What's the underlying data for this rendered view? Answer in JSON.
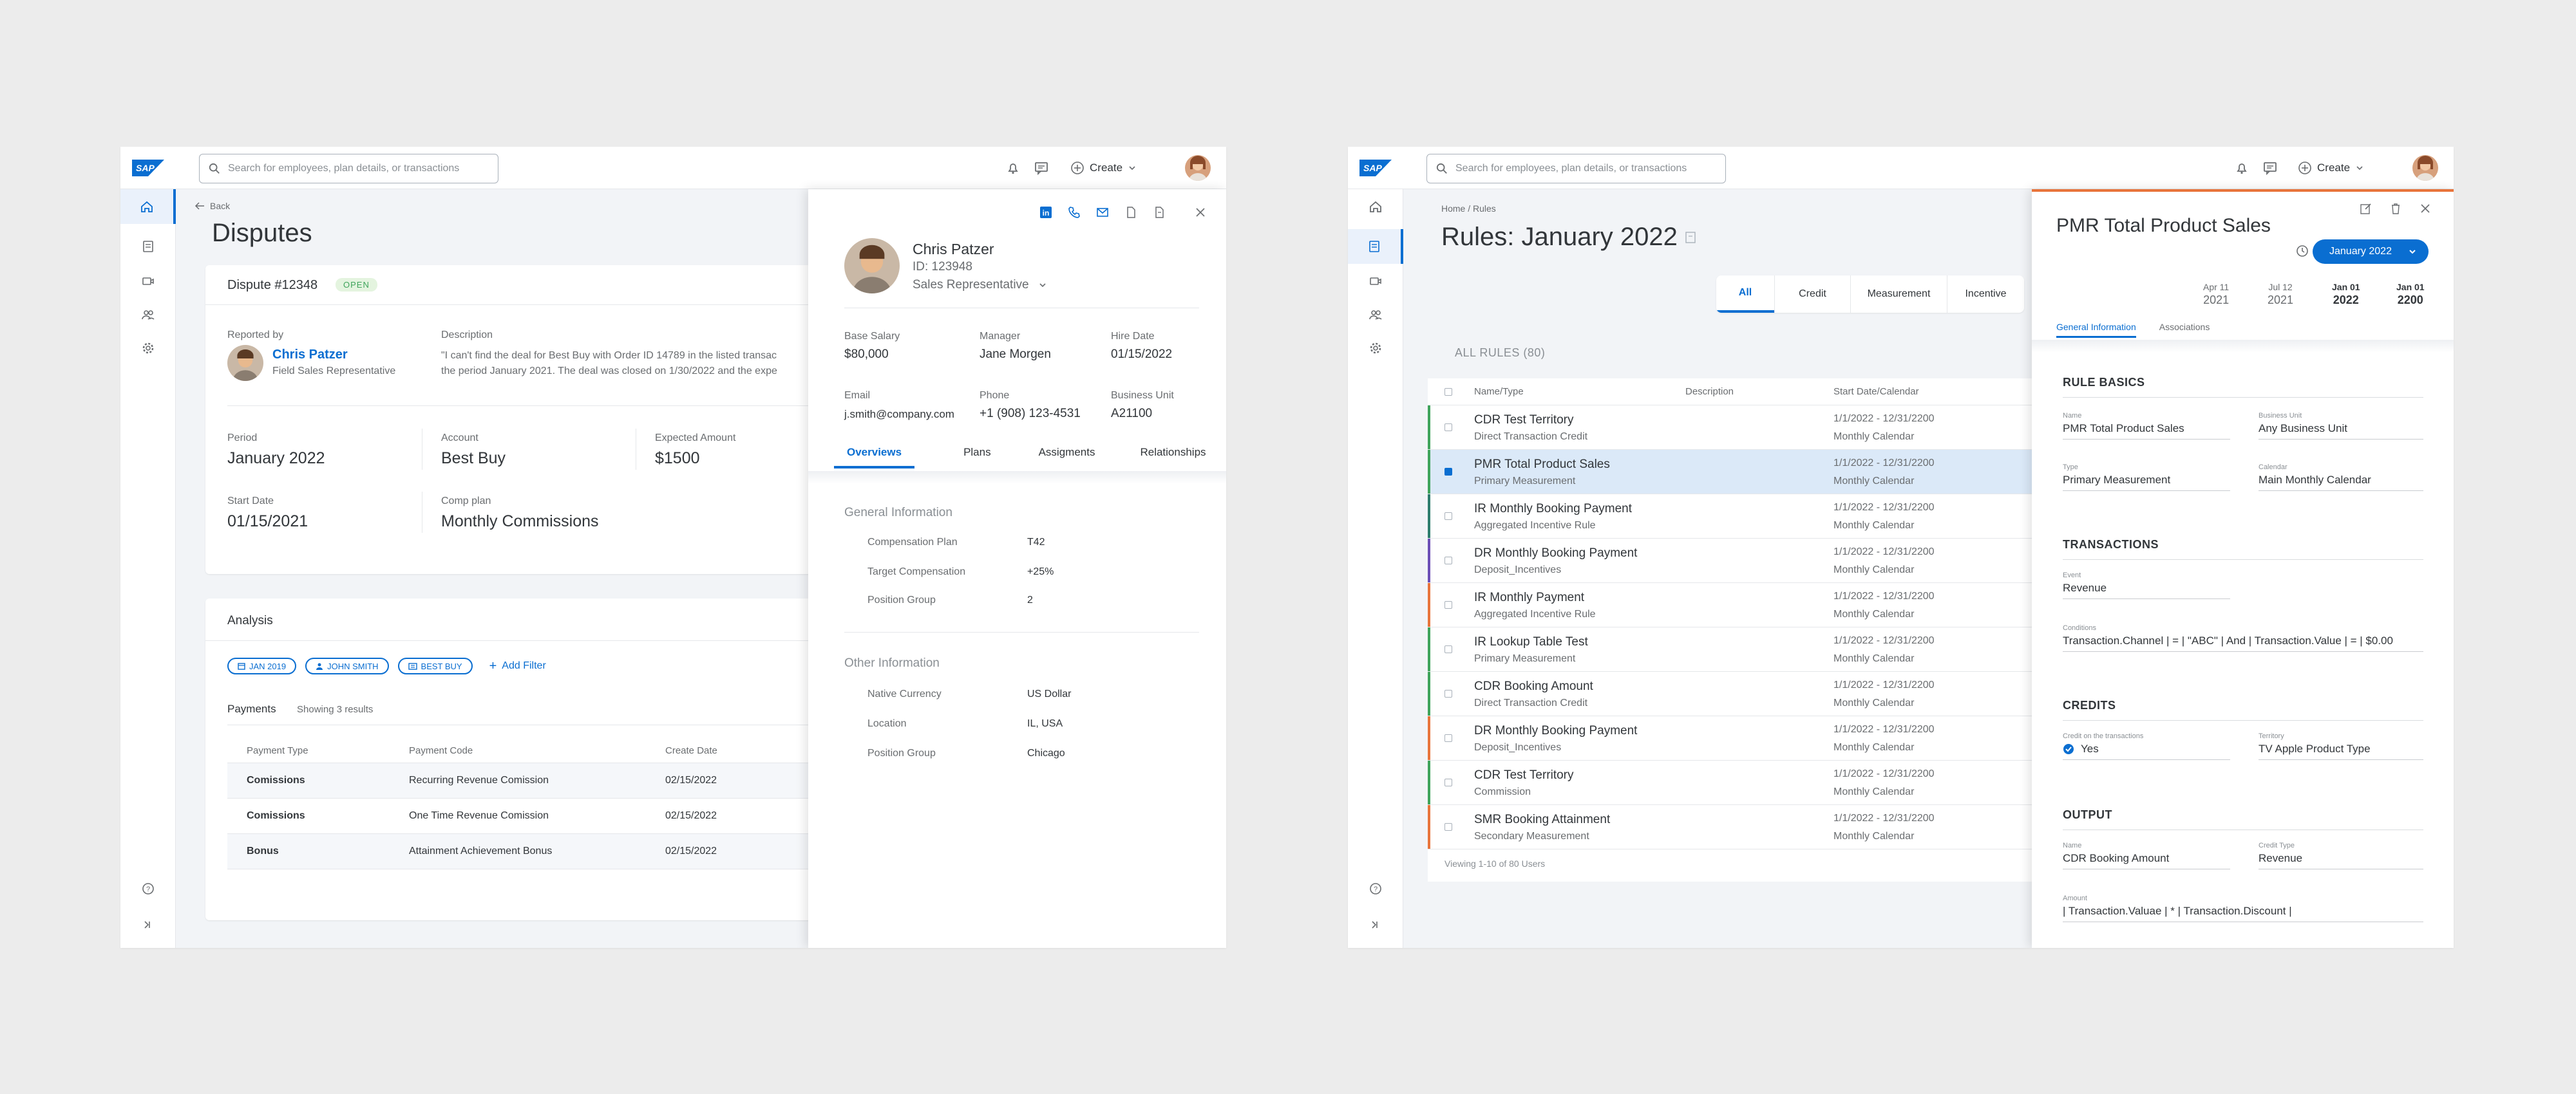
{
  "common": {
    "search_placeholder": "Search for employees, plan details, or transactions",
    "create_label": "Create"
  },
  "left": {
    "back_label": "Back",
    "page_title": "Disputes",
    "dispute": {
      "title": "Dispute  #12348",
      "status": "OPEN",
      "reported_by_label": "Reported by",
      "reporter_name": "Chris Patzer",
      "reporter_role": "Field Sales Representative",
      "description_label": "Description",
      "description_line1": "\"I can't find the deal for Best Buy with Order ID 14789  in the listed transac",
      "description_line2": "the period January 2021. The deal was closed on 1/30/2022 and the expe",
      "fields": [
        {
          "label": "Period",
          "value": "January 2022"
        },
        {
          "label": "Account",
          "value": "Best Buy"
        },
        {
          "label": "Expected Amount",
          "value": "$1500"
        },
        {
          "label": "Start Date",
          "value": "01/15/2021"
        },
        {
          "label": "Comp plan",
          "value": "Monthly Commissions"
        }
      ]
    },
    "analysis": {
      "title": "Analysis",
      "filters": [
        "JAN 2019",
        "JOHN SMITH",
        "BEST BUY"
      ],
      "add_filter": "Add Filter",
      "payments_title": "Payments",
      "payments_count": "Showing 3 results",
      "columns": [
        "Payment Type",
        "Payment Code",
        "Create Date"
      ],
      "rows": [
        [
          "Comissions",
          "Recurring Revenue Comission",
          "02/15/2022"
        ],
        [
          "Comissions",
          "One Time Revenue Comission",
          "02/15/2022"
        ],
        [
          "Bonus",
          "Attainment Achievement Bonus",
          "02/15/2022"
        ]
      ]
    },
    "employee": {
      "name": "Chris Patzer",
      "id": "ID: 123948",
      "role": "Sales Representative",
      "stats": [
        {
          "label": "Base Salary",
          "value": "$80,000"
        },
        {
          "label": "Manager",
          "value": "Jane Morgen"
        },
        {
          "label": "Hire Date",
          "value": "01/15/2022"
        },
        {
          "label": "Email",
          "value": "j.smith@company.com"
        },
        {
          "label": "Phone",
          "value": "+1 (908) 123-4531"
        },
        {
          "label": "Business Unit",
          "value": "A21100"
        }
      ],
      "tabs": [
        "Overviews",
        "Plans",
        "Assigments",
        "Relationships"
      ],
      "general_title": "General Information",
      "general": [
        {
          "label": "Compensation Plan",
          "value": "T42"
        },
        {
          "label": "Target Compensation",
          "value": "+25%"
        },
        {
          "label": "Position Group",
          "value": "2"
        }
      ],
      "other_title": "Other Information",
      "other": [
        {
          "label": "Native Currency",
          "value": "US Dollar"
        },
        {
          "label": "Location",
          "value": "IL, USA"
        },
        {
          "label": "Position Group",
          "value": "Chicago"
        }
      ]
    }
  },
  "right": {
    "breadcrumb": "Home / Rules",
    "page_title": "Rules: January 2022",
    "segments": [
      "All",
      "Credit",
      "Measurement",
      "Incentive"
    ],
    "all_rules": "ALL RULES (80)",
    "columns": [
      "Name/Type",
      "Description",
      "Start Date/Calendar"
    ],
    "rows": [
      {
        "name": "CDR Test Territory",
        "type": "Direct Transaction Credit",
        "dates": "1/1/2022 - 12/31/2200",
        "calendar": "Monthly Calendar",
        "color": "#3fa45b"
      },
      {
        "name": "PMR Total Product Sales",
        "type": "Primary Measurement",
        "dates": "1/1/2022 - 12/31/2200",
        "calendar": "Monthly Calendar",
        "color": "#3fa45b"
      },
      {
        "name": "IR Monthly Booking Payment",
        "type": "Aggregated Incentive Rule",
        "dates": "1/1/2022 - 12/31/2200",
        "calendar": "Monthly Calendar",
        "color": "#2e7d6d"
      },
      {
        "name": "DR Monthly Booking Payment",
        "type": "Deposit_Incentives",
        "dates": "1/1/2022 - 12/31/2200",
        "calendar": "Monthly Calendar",
        "color": "#6c4fb6"
      },
      {
        "name": "IR Monthly Payment",
        "type": "Aggregated Incentive Rule",
        "dates": "1/1/2022 - 12/31/2200",
        "calendar": "Monthly Calendar",
        "color": "#e8743b"
      },
      {
        "name": "IR Lookup Table Test",
        "type": "Primary Measurement",
        "dates": "1/1/2022 - 12/31/2200",
        "calendar": "Monthly Calendar",
        "color": "#3fa45b"
      },
      {
        "name": "CDR Booking Amount",
        "type": "Direct Transaction Credit",
        "dates": "1/1/2022 - 12/31/2200",
        "calendar": "Monthly Calendar",
        "color": "#3fa45b"
      },
      {
        "name": "DR Monthly Booking Payment",
        "type": "Deposit_Incentives",
        "dates": "1/1/2022 - 12/31/2200",
        "calendar": "Monthly Calendar",
        "color": "#e8743b"
      },
      {
        "name": "CDR Test Territory",
        "type": "Commission",
        "dates": "1/1/2022 - 12/31/2200",
        "calendar": "Monthly Calendar",
        "color": "#3fa45b"
      },
      {
        "name": "SMR Booking Attainment",
        "type": "Secondary Measurement",
        "dates": "1/1/2022 - 12/31/2200",
        "calendar": "Monthly Calendar",
        "color": "#e8743b"
      }
    ],
    "viewing": "Viewing 1-10 of 80 Users",
    "detail": {
      "title": "PMR Total Product Sales",
      "period": "January 2022",
      "timeline": [
        {
          "month": "Apr 11",
          "year": "2021"
        },
        {
          "month": "Jul 12",
          "year": "2021"
        },
        {
          "month": "Jan 01",
          "year": "2022"
        },
        {
          "month": "Jan 01",
          "year": "2200"
        }
      ],
      "tabs": [
        "General Information",
        "Associations"
      ],
      "rule_basics": "RULE BASICS",
      "name_label": "Name",
      "name_value": "PMR Total Product Sales",
      "bu_label": "Business Unit",
      "bu_value": "Any Business Unit",
      "type_label": "Type",
      "type_value": "Primary Measurement",
      "cal_label": "Calendar",
      "cal_value": "Main Monthly Calendar",
      "transactions": "TRANSACTIONS",
      "event_label": "Event",
      "event_value": "Revenue",
      "cond_label": "Conditions",
      "cond_value": "Transaction.Channel | = | \"ABC\" | And | Transaction.Value | = | $0.00",
      "credits": "CREDITS",
      "credit_on_label": "Credit on the transactions",
      "credit_on_value": "Yes",
      "territory_label": "Territory",
      "territory_value": "TV Apple Product Type",
      "output": "OUTPUT",
      "out_name_label": "Name",
      "out_name_value": "CDR Booking Amount",
      "credit_type_label": "Credit Type",
      "credit_type_value": "Revenue",
      "amount_label": "Amount",
      "amount_value": "| Transaction.Valuae | * | Transaction.Discount |"
    }
  }
}
